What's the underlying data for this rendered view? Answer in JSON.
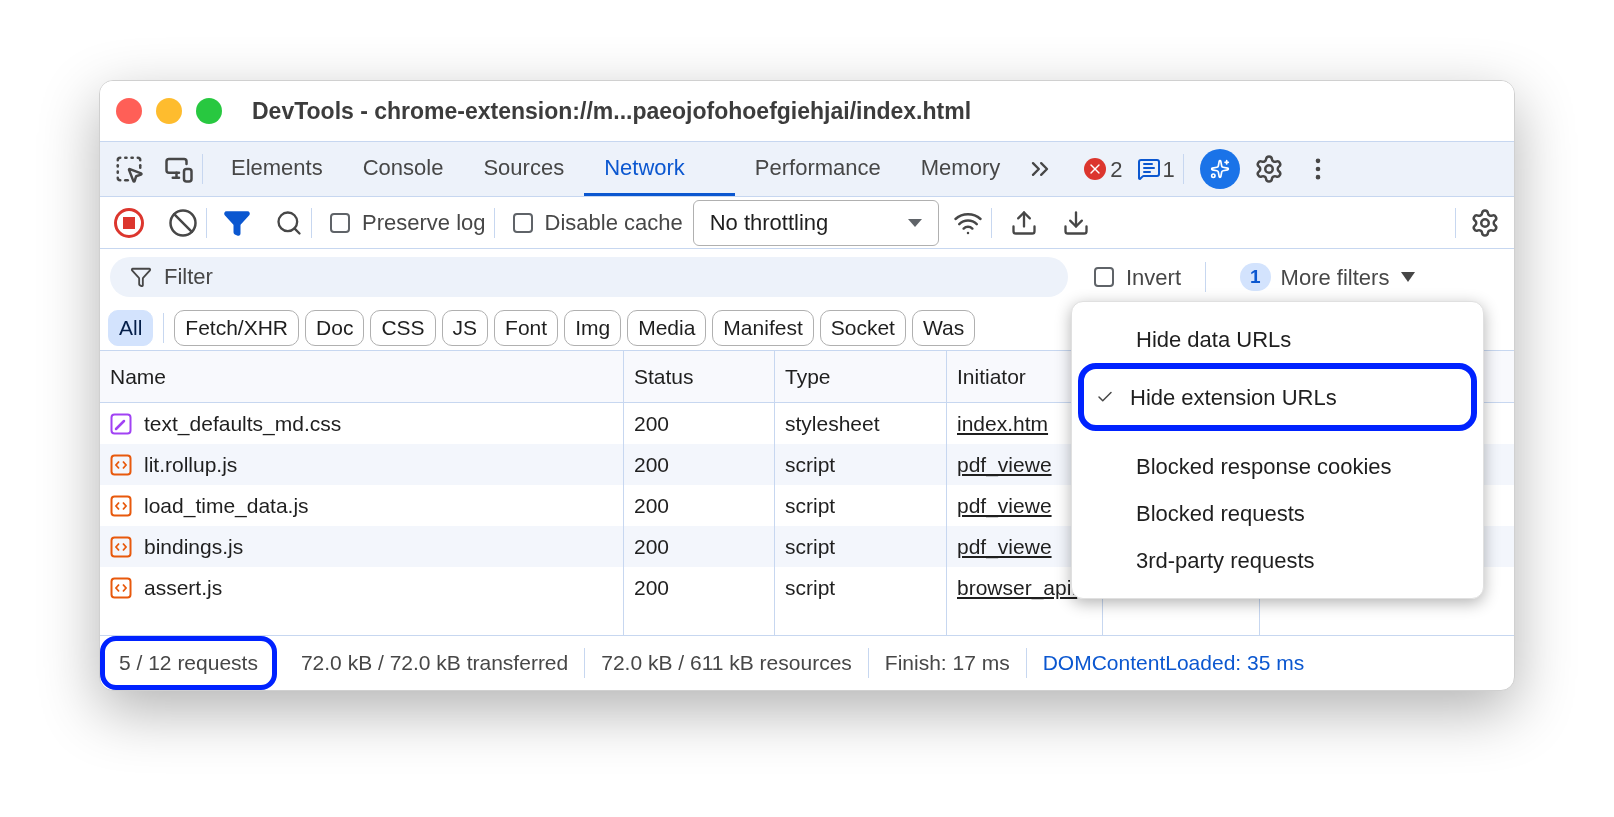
{
  "window": {
    "title": "DevTools - chrome-extension://m...paeojofohoefgiehjai/index.html"
  },
  "tabs": [
    {
      "label": "Elements",
      "selected": false
    },
    {
      "label": "Console",
      "selected": false
    },
    {
      "label": "Sources",
      "selected": false
    },
    {
      "label": "Network",
      "selected": true
    },
    {
      "label": "Performance",
      "selected": false
    },
    {
      "label": "Memory",
      "selected": false
    }
  ],
  "issues": {
    "errors": "2",
    "messages": "1"
  },
  "toolbar": {
    "preserve_log": {
      "label": "Preserve log",
      "checked": false
    },
    "disable_cache": {
      "label": "Disable cache",
      "checked": false
    },
    "throttling": "No throttling"
  },
  "filter": {
    "placeholder": "Filter",
    "invert": {
      "label": "Invert",
      "checked": false
    },
    "more_filters_count": "1",
    "more_filters": "More filters"
  },
  "type_filters": [
    {
      "label": "All",
      "selected": true
    },
    {
      "label": "Fetch/XHR",
      "selected": false
    },
    {
      "label": "Doc",
      "selected": false
    },
    {
      "label": "CSS",
      "selected": false
    },
    {
      "label": "JS",
      "selected": false
    },
    {
      "label": "Font",
      "selected": false
    },
    {
      "label": "Img",
      "selected": false
    },
    {
      "label": "Media",
      "selected": false
    },
    {
      "label": "Manifest",
      "selected": false
    },
    {
      "label": "Socket",
      "selected": false
    },
    {
      "label": "Was",
      "selected": false
    }
  ],
  "table": {
    "columns": [
      "Name",
      "Status",
      "Type",
      "Initiator"
    ],
    "rows": [
      {
        "kind": "css",
        "name": "text_defaults_md.css",
        "status": "200",
        "type": "stylesheet",
        "initiator": "index.htm"
      },
      {
        "kind": "script",
        "name": "lit.rollup.js",
        "status": "200",
        "type": "script",
        "initiator": "pdf_viewe"
      },
      {
        "kind": "script",
        "name": "load_time_data.js",
        "status": "200",
        "type": "script",
        "initiator": "pdf_viewe"
      },
      {
        "kind": "script",
        "name": "bindings.js",
        "status": "200",
        "type": "script",
        "initiator": "pdf_viewe"
      },
      {
        "kind": "script",
        "name": "assert.js",
        "status": "200",
        "type": "script",
        "initiator": "browser_api."
      }
    ]
  },
  "status_bar": [
    {
      "text": "5 / 12 requests",
      "highlighted": true,
      "kind": "plain"
    },
    {
      "text": "72.0 kB / 72.0 kB transferred",
      "highlighted": false,
      "kind": "plain"
    },
    {
      "text": "72.0 kB / 611 kB resources",
      "highlighted": false,
      "kind": "plain"
    },
    {
      "text": "Finish: 17 ms",
      "highlighted": false,
      "kind": "plain"
    },
    {
      "text": "DOMContentLoaded: 35 ms",
      "highlighted": false,
      "kind": "link"
    }
  ],
  "more_filters_menu": [
    {
      "label": "Hide data URLs",
      "checked": false,
      "highlighted": false
    },
    {
      "label": "Hide extension URLs",
      "checked": true,
      "highlighted": true
    },
    {
      "kind": "separator"
    },
    {
      "label": "Blocked response cookies",
      "checked": false,
      "highlighted": false
    },
    {
      "label": "Blocked requests",
      "checked": false,
      "highlighted": false
    },
    {
      "label": "3rd-party requests",
      "checked": false,
      "highlighted": false
    }
  ]
}
